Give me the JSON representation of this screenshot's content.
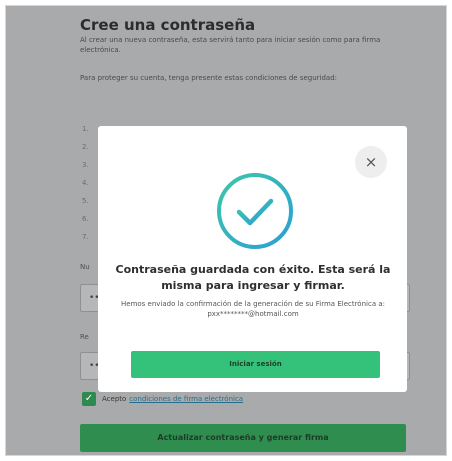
{
  "page": {
    "title": "Cree una contraseña",
    "intro": "Al crear una nueva contraseña, esta servirá tanto para iniciar sesión como para firma electrónica.",
    "protect_text": "Para proteger su cuenta, tenga presente estas condiciones de seguridad:",
    "conditions": [
      "1.",
      "2.",
      "3.",
      "4.",
      "5.",
      "6.",
      "7."
    ],
    "password_label": "Nu",
    "password_value": "••",
    "repeat_label": "Re",
    "repeat_value": "••",
    "accept_text": "Acepto",
    "accept_link": "condiciones de firma electrónica",
    "checkbox_mark": "✓",
    "submit_label": "Actualizar contraseña y generar firma"
  },
  "modal": {
    "close_glyph": "×",
    "heading": "Contraseña guardada con éxito. Esta será la misma para ingresar y firmar.",
    "message": "Hemos enviado la confirmación de la generación de su Firma Electrónica a: pxx********@hotmail.com",
    "button_label": "Iniciar sesión"
  },
  "icons": {
    "success": "check-circle-icon",
    "close": "close-icon",
    "checkbox": "checkmark-icon"
  },
  "colors": {
    "overlay": "#a9aaac",
    "primary_green": "#2f8e4f",
    "modal_button": "#34c27a",
    "success_gradient_start": "#3ec6a8",
    "success_gradient_end": "#2a9fd6"
  }
}
